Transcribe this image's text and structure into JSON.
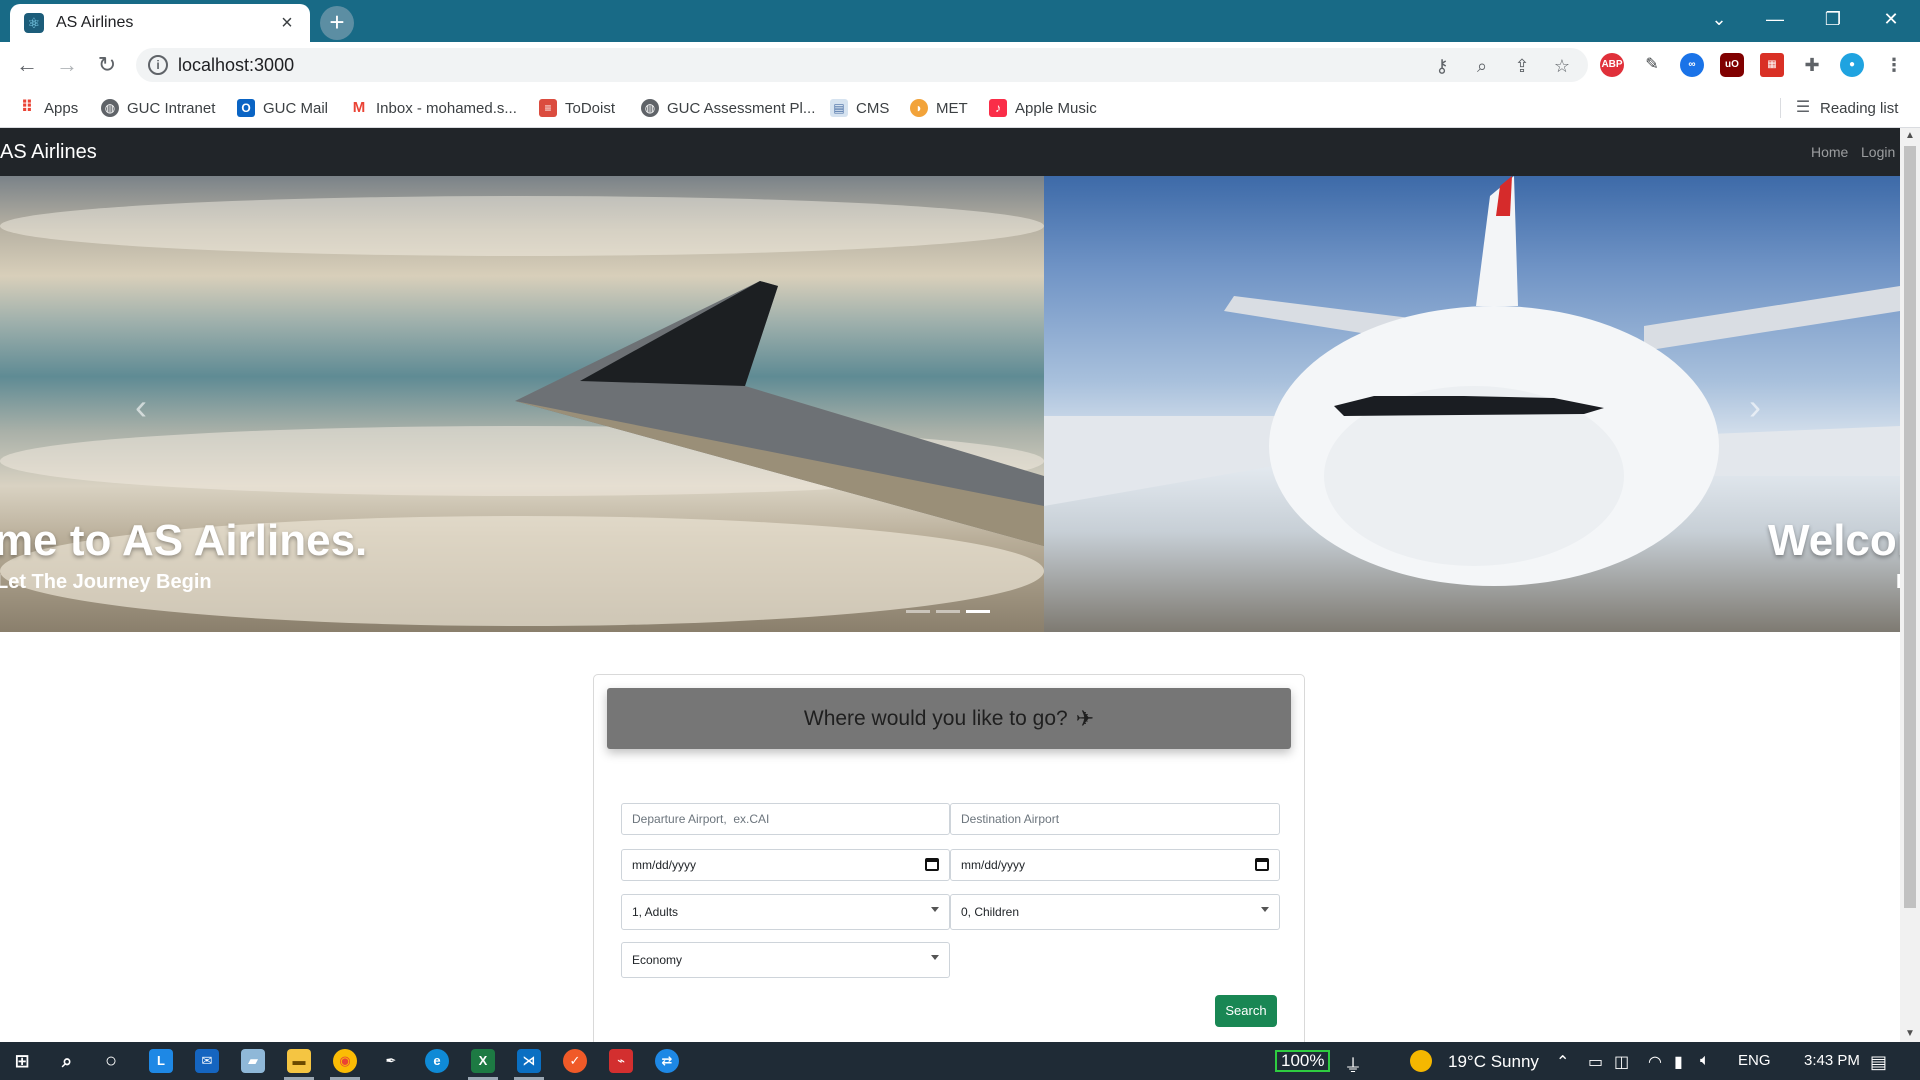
{
  "browser": {
    "tab_title": "AS Airlines",
    "url": "localhost:3000",
    "bookmarks": [
      "Apps",
      "GUC Intranet",
      "GUC Mail",
      "Inbox - mohamed.s...",
      "ToDoist",
      "GUC Assessment Pl...",
      "CMS",
      "MET",
      "Apple Music"
    ],
    "reading_list": "Reading list",
    "extensions": [
      "ABP",
      "uO"
    ]
  },
  "site": {
    "brand": "AS Airlines",
    "nav_links": [
      "Home",
      "Login"
    ]
  },
  "carousel": {
    "left_caption_title": "me to AS Airlines.",
    "left_caption_sub": "Let The Journey Begin",
    "right_caption_title": "Welcom",
    "right_caption_sub": "L",
    "slide_count": 3,
    "active_slide": 3
  },
  "form": {
    "title": "Where would you like to go?",
    "departure_placeholder": "Departure Airport,  ex.CAI",
    "destination_placeholder": "Destination Airport",
    "departure_date": "mm/dd/yyyy",
    "return_date": "mm/dd/yyyy",
    "adults": "1, Adults",
    "children": "0, Children",
    "cabin_class": "Economy",
    "search_label": "Search"
  },
  "taskbar": {
    "battery": "100%",
    "weather": "19°C  Sunny",
    "language": "ENG",
    "time": "3:43 PM"
  },
  "colors": {
    "tab_strip": "#186a86",
    "navbar": "#212529",
    "card_header": "#767676",
    "search_button": "#198754"
  }
}
